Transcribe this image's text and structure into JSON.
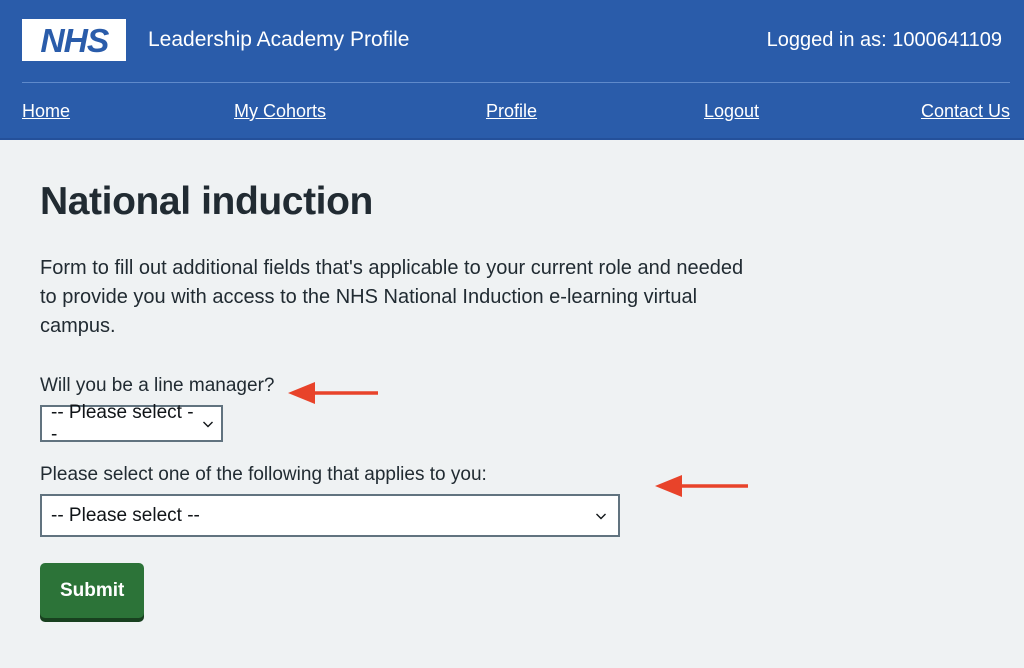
{
  "header": {
    "logo_text": "NHS",
    "logo_icon": "nhs-logo",
    "site_title": "Leadership Academy Profile",
    "logged_in_text": "Logged in as: 1000641109",
    "brand_color": "#2a5caa"
  },
  "nav": {
    "items": [
      {
        "label": "Home"
      },
      {
        "label": "My Cohorts"
      },
      {
        "label": "Profile"
      },
      {
        "label": "Logout"
      },
      {
        "label": "Contact Us"
      }
    ]
  },
  "main": {
    "page_title": "National induction",
    "intro": "Form to fill out additional fields that's applicable to your current role and needed to provide you with access to the NHS National Induction e-learning virtual campus.",
    "fields": [
      {
        "label": "Will you be a line manager?",
        "value": "-- Please select --",
        "chevron_icon": "chevron-down-icon"
      },
      {
        "label": "Please select one of the following that applies to you:",
        "value": "-- Please select --",
        "chevron_icon": "chevron-down-icon"
      }
    ],
    "submit_label": "Submit",
    "submit_color": "#2c7338"
  },
  "annotations": {
    "arrow_color": "#e8432a",
    "arrows": [
      {
        "name": "arrow-pointing-to-line-manager-select",
        "direction": "left"
      },
      {
        "name": "arrow-pointing-to-applies-to-you-select",
        "direction": "left"
      }
    ]
  }
}
